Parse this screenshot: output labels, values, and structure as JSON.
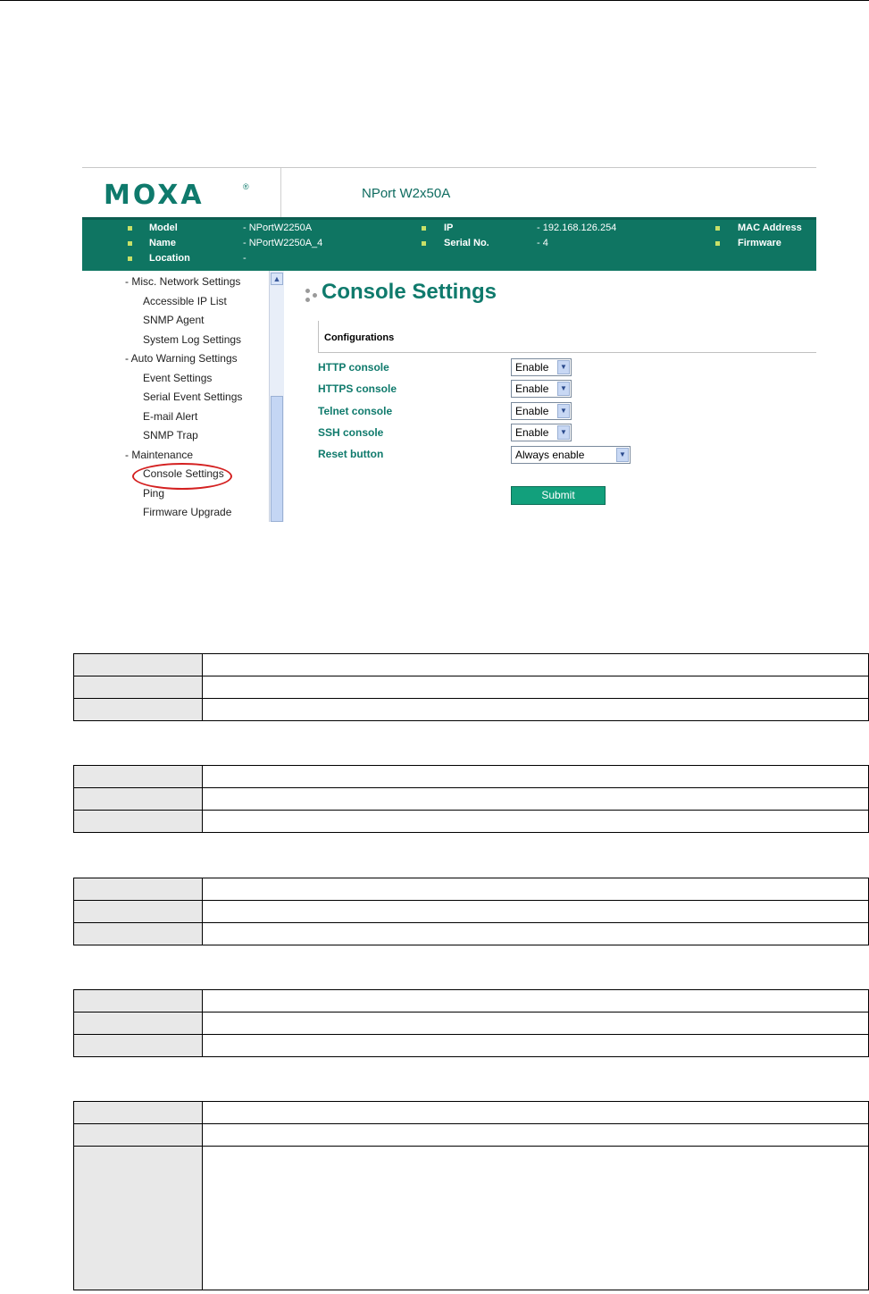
{
  "screenshot": {
    "logo": "MOXA",
    "logo_mark": "®",
    "product_name": "NPort W2x50A",
    "banner": {
      "col1": [
        {
          "label": "Model",
          "value": "- NPortW2250A"
        },
        {
          "label": "Name",
          "value": "- NPortW2250A_4"
        },
        {
          "label": "Location",
          "value": "-"
        }
      ],
      "col2": [
        {
          "label": "IP",
          "value": "- 192.168.126.254"
        },
        {
          "label": "Serial No.",
          "value": "- 4"
        }
      ],
      "col3": [
        {
          "label": "MAC Address"
        },
        {
          "label": "Firmware"
        }
      ]
    },
    "sidebar": [
      "- Misc. Network Settings",
      "Accessible IP List",
      "SNMP Agent",
      "System Log Settings",
      "- Auto Warning Settings",
      "Event Settings",
      "Serial Event Settings",
      "E-mail Alert",
      "SNMP Trap",
      "- Maintenance",
      "Console Settings",
      "Ping",
      "Firmware Upgrade"
    ],
    "page_title": "Console Settings",
    "section_title": "Configurations",
    "rows": [
      {
        "label": "HTTP console",
        "value": "Enable"
      },
      {
        "label": "HTTPS console",
        "value": "Enable"
      },
      {
        "label": "Telnet console",
        "value": "Enable"
      },
      {
        "label": "SSH console",
        "value": "Enable"
      },
      {
        "label": "Reset button",
        "value": "Always enable"
      }
    ],
    "submit_label": "Submit"
  },
  "colors": {
    "brand_teal": "#0f7a6c",
    "banner_green": "#0f7562",
    "bullet": "#c8e068",
    "highlight_circle": "#d42020",
    "submit_green": "#12a07c",
    "table_key_fill": "#e8e8e8"
  },
  "icons": [
    "dropdown-arrow-icon",
    "scroll-up-arrow-icon",
    "bullet-dots-icon"
  ]
}
